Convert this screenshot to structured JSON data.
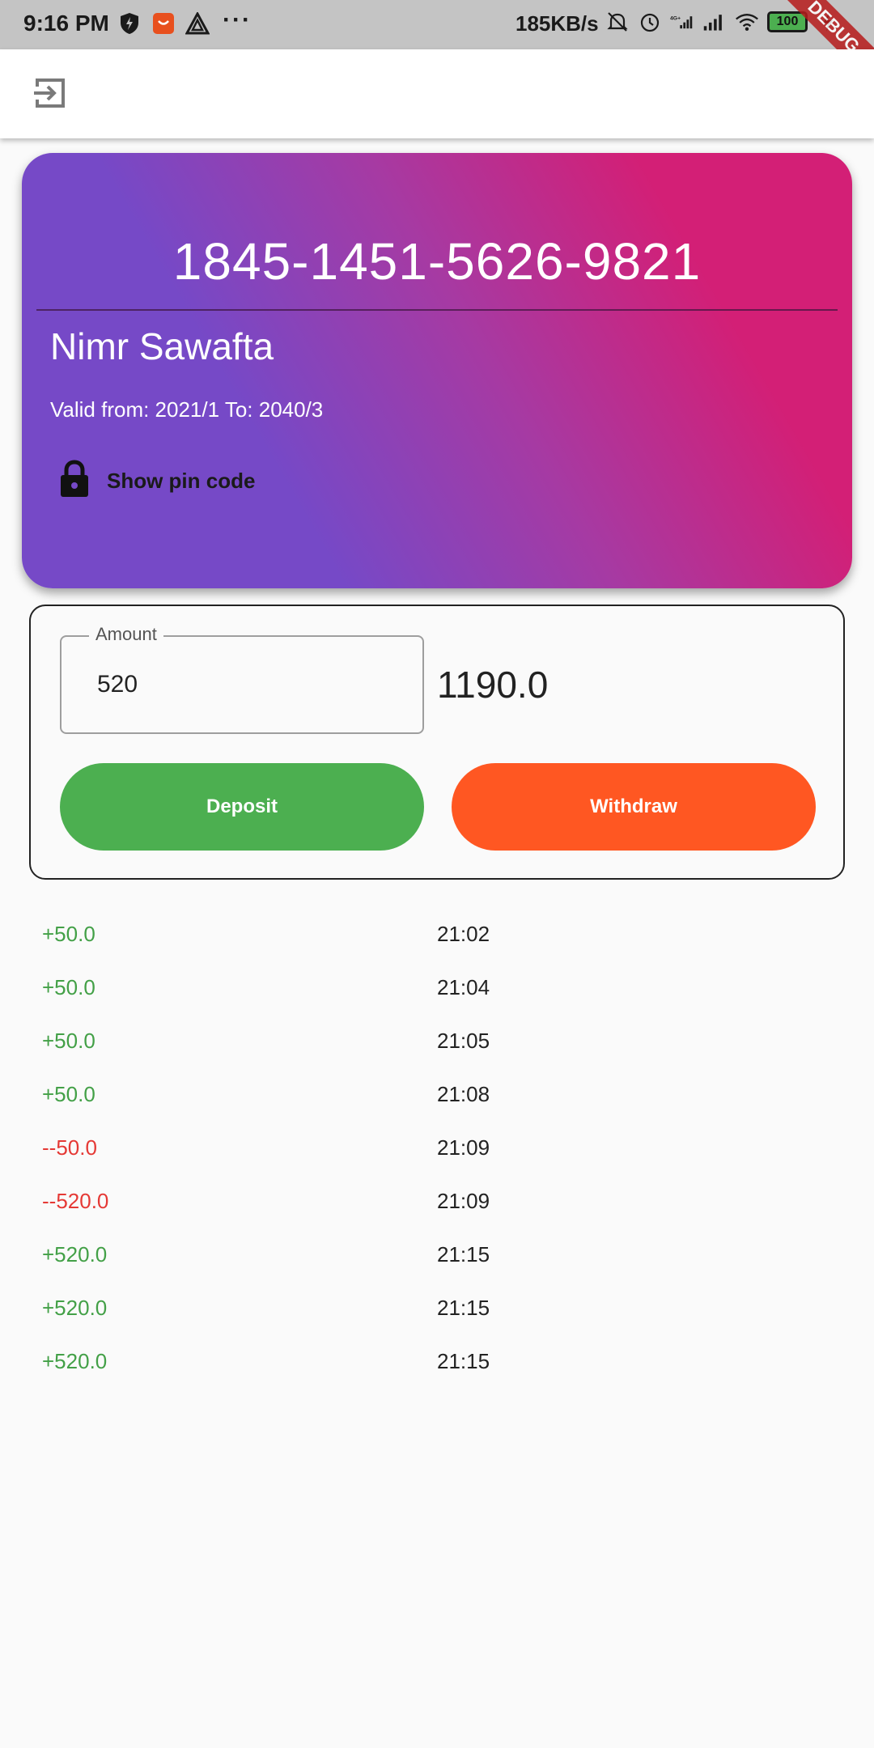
{
  "status_bar": {
    "time": "9:16 PM",
    "more": "···",
    "speed": "185KB/s",
    "battery": "100",
    "debug_banner": "DEBUG",
    "icons": [
      "shield-bolt-icon",
      "app-notification-icon",
      "triangle-app-icon",
      "mute-bell-icon",
      "alarm-icon",
      "signal-4g-icon",
      "signal-icon",
      "wifi-icon",
      "battery-icon",
      "charging-icon"
    ]
  },
  "app_bar": {
    "logout_icon": "logout-icon"
  },
  "card": {
    "number": "1845-1451-5626-9821",
    "holder_name": "Nimr Sawafta",
    "valid_text": "Valid from: 2021/1 To: 2040/3",
    "pin_label": "Show pin code",
    "gradient_colors": [
      "#7649c7",
      "#a63aa3",
      "#d31f76"
    ]
  },
  "transaction": {
    "amount_label": "Amount",
    "amount_value": "520",
    "balance": "1190.0",
    "deposit_label": "Deposit",
    "withdraw_label": "Withdraw",
    "deposit_color": "#4caf50",
    "withdraw_color": "#ff5722"
  },
  "history": [
    {
      "amount": "+50.0",
      "time": "21:02",
      "type": "pos"
    },
    {
      "amount": "+50.0",
      "time": "21:04",
      "type": "pos"
    },
    {
      "amount": "+50.0",
      "time": "21:05",
      "type": "pos"
    },
    {
      "amount": "+50.0",
      "time": "21:08",
      "type": "pos"
    },
    {
      "amount": "--50.0",
      "time": "21:09",
      "type": "neg"
    },
    {
      "amount": "--520.0",
      "time": "21:09",
      "type": "neg"
    },
    {
      "amount": "+520.0",
      "time": "21:15",
      "type": "pos"
    },
    {
      "amount": "+520.0",
      "time": "21:15",
      "type": "pos"
    },
    {
      "amount": "+520.0",
      "time": "21:15",
      "type": "pos"
    }
  ]
}
